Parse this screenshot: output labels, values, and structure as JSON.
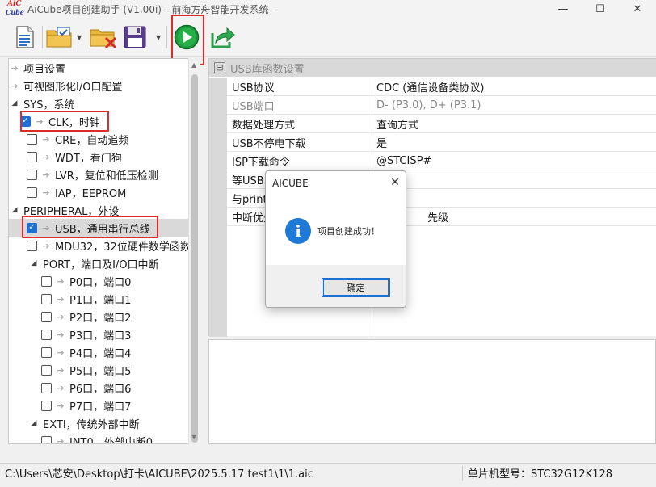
{
  "window": {
    "logo_top": "AiC",
    "logo_bottom": "Cube",
    "title": "AiCube项目创建助手 (V1.00i) --前海方舟智能开发系统--",
    "minimize": "—",
    "maximize": "☐",
    "close": "✕"
  },
  "toolbar": {
    "buttons": [
      {
        "icon": "new-document-icon"
      },
      {
        "icon": "open-folder-check-icon"
      },
      {
        "icon": "delete-folder-icon"
      },
      {
        "icon": "save-disk-icon"
      },
      {
        "icon": "run-play-icon"
      },
      {
        "icon": "export-share-icon"
      }
    ],
    "dropdown_glyph": "▼"
  },
  "tree": {
    "items": [
      {
        "label": "项目设置"
      },
      {
        "label": "可视图形化I/O口配置"
      },
      {
        "label": "SYS，系统"
      },
      {
        "label": "CLK，时钟",
        "checked": true
      },
      {
        "label": "CRE，自动追频",
        "checked": false
      },
      {
        "label": "WDT，看门狗",
        "checked": false
      },
      {
        "label": "LVR，复位和低压检测",
        "checked": false
      },
      {
        "label": "IAP，EEPROM",
        "checked": false
      },
      {
        "label": "PERIPHERAL，外设"
      },
      {
        "label": "USB，通用串行总线",
        "checked": true
      },
      {
        "label": "MDU32，32位硬件数学函数",
        "checked": false
      },
      {
        "label": "PORT，端口及I/O口中断"
      },
      {
        "label": "P0口，端口0",
        "checked": false
      },
      {
        "label": "P1口，端口1",
        "checked": false
      },
      {
        "label": "P2口，端口2",
        "checked": false
      },
      {
        "label": "P3口，端口3",
        "checked": false
      },
      {
        "label": "P4口，端口4",
        "checked": false
      },
      {
        "label": "P5口，端口5",
        "checked": false
      },
      {
        "label": "P6口，端口6",
        "checked": false
      },
      {
        "label": "P7口，端口7",
        "checked": false
      },
      {
        "label": "EXTI，传统外部中断"
      },
      {
        "label": "INT0，外部中断0",
        "checked": false
      }
    ]
  },
  "properties": {
    "section_title": "USB库函数设置",
    "collapse_glyph": "⊟",
    "rows": [
      {
        "key": "USB协议",
        "value": "CDC (通信设备类协议)"
      },
      {
        "key": "USB端口",
        "value": "D- (P3.0), D+ (P3.1)"
      },
      {
        "key": "数据处理方式",
        "value": "查询方式"
      },
      {
        "key": "USB不停电下载",
        "value": "是"
      },
      {
        "key": "ISP下载命令",
        "value": "@STCISP#"
      },
      {
        "key": "等USB",
        "value": ""
      },
      {
        "key": "与print",
        "value": ""
      },
      {
        "key": "中断优先",
        "value": "先级"
      }
    ]
  },
  "status": {
    "path": "C:\\Users\\芯安\\Desktop\\打卡\\AICUBE\\2025.5.17 test1\\1\\1.aic",
    "chip": "单片机型号：STC32G12K128"
  },
  "dialog": {
    "title": "AICUBE",
    "close": "✕",
    "icon_glyph": "i",
    "message": "项目创建成功！",
    "ok_label": "确定"
  },
  "colors": {
    "highlight": "#e02a2a",
    "accent": "#1f6fd1",
    "info": "#1f79d6",
    "run_green": "#1e9a3c"
  }
}
